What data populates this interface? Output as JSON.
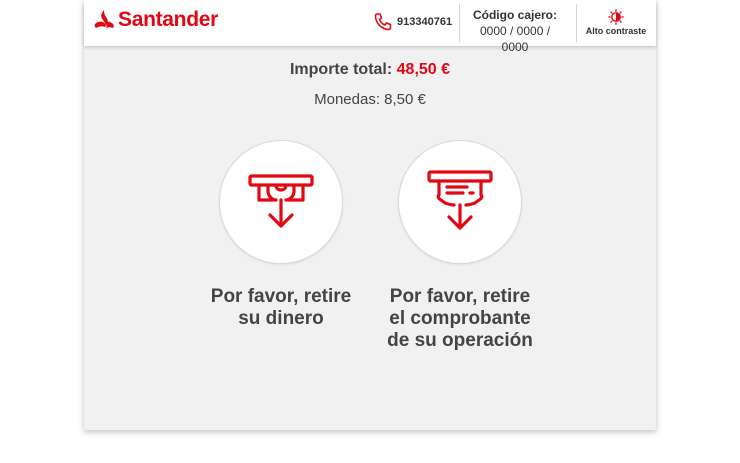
{
  "header": {
    "brand": "Santander",
    "phone": "913340761",
    "cashier_label": "Código cajero:",
    "cashier_code": "0000 / 0000 / 0000",
    "contrast_label": "Alto contraste"
  },
  "summary": {
    "total_label": "Importe total:",
    "total_amount": "48,50 €",
    "coins_text": "Monedas: 8,50 €"
  },
  "actions": [
    {
      "line1": "Por favor, retire",
      "line2": "su dinero",
      "line3": "",
      "icon": "take-cash-icon"
    },
    {
      "line1": "Por favor, retire",
      "line2": "el comprobante",
      "line3": "de su operación",
      "icon": "take-receipt-icon"
    }
  ],
  "colors": {
    "brand": "#e30613",
    "background": "#f1f1f1"
  }
}
